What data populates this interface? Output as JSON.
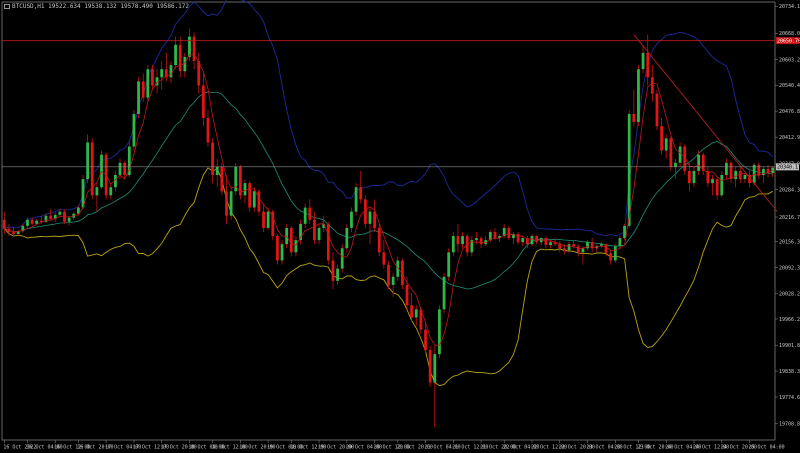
{
  "title": {
    "symbol": "BTCUSD,H1",
    "ohlc": "19522.634 19538.132 19578.490 19586.172"
  },
  "colors": {
    "background": "#000000",
    "frame": "#7f7f7f",
    "bull": "#2fb84a",
    "bear": "#e01515",
    "wick": "#c81414",
    "upper_band": "#1c2a9c",
    "middle_band": "#1f8f7a",
    "lower_band": "#b8a414",
    "fast_ma": "#c01a1a",
    "trendline": "#b01c1c",
    "level_line": "#c01a1a",
    "bid_line": "#8c8c8c",
    "level_tag": "#c81414",
    "bid_tag": "#bcbcbc",
    "text": "#c8c8c8"
  },
  "chart_data": {
    "type": "candlestick",
    "ylim": [
      19669,
      20745
    ],
    "price_ticks": [
      {
        "v": 20734.172,
        "label": "20734.172"
      },
      {
        "v": 20668.08,
        "label": "20668.080"
      },
      {
        "v": 20603.22,
        "label": "20603.220"
      },
      {
        "v": 20540.44,
        "label": "20540.440"
      },
      {
        "v": 20476.88,
        "label": "20476.880"
      },
      {
        "v": 20412.9,
        "label": "20412.900"
      },
      {
        "v": 20347.95,
        "label": "20347.950"
      },
      {
        "v": 20284.38,
        "label": "20284.380"
      },
      {
        "v": 20216.75,
        "label": "20216.750"
      },
      {
        "v": 20156.38,
        "label": "20156.380"
      },
      {
        "v": 20092.315,
        "label": "20092.315"
      },
      {
        "v": 20028.235,
        "label": "20028.235"
      },
      {
        "v": 19966.21,
        "label": "19966.210"
      },
      {
        "v": 19901.88,
        "label": "19901.880"
      },
      {
        "v": 19838.395,
        "label": "19838.395"
      },
      {
        "v": 19774.69,
        "label": "19774.690"
      },
      {
        "v": 19708.825,
        "label": "19708.825"
      },
      {
        "v": 19646.15,
        "label": "19646.150"
      },
      {
        "v": 19580.62,
        "label": "19580.620"
      },
      {
        "v": 19519.45,
        "label": "19519.450"
      },
      {
        "v": 19458.595,
        "label": "19458.595"
      },
      {
        "v": 19393.05,
        "label": "19393.050"
      },
      {
        "v": 19326.79,
        "label": "19326.790"
      }
    ],
    "time_ticks": [
      {
        "i": 0,
        "label": "16 Oct 2022"
      },
      {
        "i": 5,
        "label": "16 Oct 04:00"
      },
      {
        "i": 11,
        "label": "16 Oct 12:00"
      },
      {
        "i": 16,
        "label": "16 Oct 20:00"
      },
      {
        "i": 22,
        "label": "17 Oct 04:00"
      },
      {
        "i": 28,
        "label": "17 Oct 12:00"
      },
      {
        "i": 34,
        "label": "17 Oct 20:00"
      },
      {
        "i": 40,
        "label": "18 Oct 04:00"
      },
      {
        "i": 45,
        "label": "18 Oct 12:00"
      },
      {
        "i": 51,
        "label": "18 Oct 20:00"
      },
      {
        "i": 57,
        "label": "19 Oct 04:00"
      },
      {
        "i": 62,
        "label": "19 Oct 12:00"
      },
      {
        "i": 68,
        "label": "19 Oct 20:00"
      },
      {
        "i": 74,
        "label": "20 Oct 04:00"
      },
      {
        "i": 80,
        "label": "20 Oct 12:00"
      },
      {
        "i": 85,
        "label": "20 Oct 20:00"
      },
      {
        "i": 91,
        "label": "21 Oct 04:00"
      },
      {
        "i": 97,
        "label": "21 Oct 12:00"
      },
      {
        "i": 103,
        "label": "21 Oct 20:00"
      },
      {
        "i": 108,
        "label": "22 Oct 04:00"
      },
      {
        "i": 114,
        "label": "22 Oct 12:00"
      },
      {
        "i": 120,
        "label": "22 Oct 20:00"
      },
      {
        "i": 126,
        "label": "23 Oct 04:00"
      },
      {
        "i": 132,
        "label": "23 Oct 12:00"
      },
      {
        "i": 137,
        "label": "23 Oct 20:00"
      },
      {
        "i": 143,
        "label": "24 Oct 04:00"
      },
      {
        "i": 149,
        "label": "24 Oct 12:00"
      },
      {
        "i": 155,
        "label": "24 Oct 20:00"
      },
      {
        "i": 161,
        "label": "25 Oct 04:00"
      }
    ],
    "horizontal_level": {
      "v": 20650,
      "label": "20650.762"
    },
    "bid_level": {
      "v": 20340,
      "label": "20340.172"
    },
    "trendline": {
      "from": {
        "i": 136,
        "v": 20665
      },
      "to": {
        "i": 167,
        "v": 20230
      }
    },
    "candles": [
      [
        20210,
        20230,
        20175,
        20188
      ],
      [
        20188,
        20200,
        20170,
        20180
      ],
      [
        20180,
        20192,
        20168,
        20175
      ],
      [
        20175,
        20185,
        20170,
        20182
      ],
      [
        20182,
        20200,
        20178,
        20195
      ],
      [
        20195,
        20215,
        20190,
        20210
      ],
      [
        20210,
        20216,
        20195,
        20200
      ],
      [
        20200,
        20212,
        20198,
        20208
      ],
      [
        20208,
        20220,
        20200,
        20205
      ],
      [
        20205,
        20225,
        20202,
        20220
      ],
      [
        20220,
        20236,
        20210,
        20212
      ],
      [
        20212,
        20228,
        20205,
        20222
      ],
      [
        20222,
        20236,
        20218,
        20230
      ],
      [
        20230,
        20236,
        20200,
        20205
      ],
      [
        20205,
        20220,
        20195,
        20215
      ],
      [
        20215,
        20230,
        20210,
        20225
      ],
      [
        20225,
        20245,
        20220,
        20240
      ],
      [
        20240,
        20320,
        20235,
        20310
      ],
      [
        20310,
        20420,
        20300,
        20400
      ],
      [
        20400,
        20410,
        20260,
        20270
      ],
      [
        20270,
        20300,
        20230,
        20290
      ],
      [
        20290,
        20380,
        20285,
        20370
      ],
      [
        20370,
        20375,
        20260,
        20270
      ],
      [
        20270,
        20300,
        20260,
        20290
      ],
      [
        20290,
        20330,
        20280,
        20320
      ],
      [
        20320,
        20360,
        20310,
        20350
      ],
      [
        20350,
        20355,
        20310,
        20320
      ],
      [
        20320,
        20400,
        20315,
        20390
      ],
      [
        20390,
        20480,
        20380,
        20470
      ],
      [
        20470,
        20560,
        20460,
        20550
      ],
      [
        20550,
        20570,
        20500,
        20510
      ],
      [
        20510,
        20590,
        20500,
        20580
      ],
      [
        20580,
        20590,
        20530,
        20540
      ],
      [
        20540,
        20580,
        20520,
        20560
      ],
      [
        20560,
        20600,
        20530,
        20580
      ],
      [
        20580,
        20620,
        20550,
        20560
      ],
      [
        20560,
        20600,
        20545,
        20590
      ],
      [
        20590,
        20660,
        20580,
        20640
      ],
      [
        20640,
        20660,
        20560,
        20575
      ],
      [
        20575,
        20620,
        20560,
        20610
      ],
      [
        20610,
        20680,
        20600,
        20660
      ],
      [
        20660,
        20670,
        20580,
        20600
      ],
      [
        20600,
        20620,
        20520,
        20540
      ],
      [
        20540,
        20570,
        20440,
        20460
      ],
      [
        20460,
        20480,
        20390,
        20400
      ],
      [
        20400,
        20410,
        20300,
        20320
      ],
      [
        20320,
        20360,
        20290,
        20340
      ],
      [
        20340,
        20350,
        20270,
        20280
      ],
      [
        20280,
        20320,
        20200,
        20220
      ],
      [
        20220,
        20290,
        20210,
        20280
      ],
      [
        20280,
        20350,
        20270,
        20340
      ],
      [
        20340,
        20345,
        20260,
        20270
      ],
      [
        20270,
        20310,
        20250,
        20300
      ],
      [
        20300,
        20305,
        20230,
        20240
      ],
      [
        20240,
        20290,
        20230,
        20280
      ],
      [
        20280,
        20285,
        20220,
        20230
      ],
      [
        20230,
        20250,
        20180,
        20190
      ],
      [
        20190,
        20240,
        20185,
        20230
      ],
      [
        20230,
        20235,
        20160,
        20170
      ],
      [
        20170,
        20175,
        20100,
        20110
      ],
      [
        20110,
        20160,
        20100,
        20150
      ],
      [
        20150,
        20200,
        20140,
        20190
      ],
      [
        20190,
        20195,
        20120,
        20130
      ],
      [
        20130,
        20170,
        20120,
        20160
      ],
      [
        20160,
        20210,
        20150,
        20200
      ],
      [
        20200,
        20250,
        20190,
        20240
      ],
      [
        20240,
        20260,
        20200,
        20210
      ],
      [
        20210,
        20230,
        20150,
        20160
      ],
      [
        20160,
        20200,
        20150,
        20190
      ],
      [
        20190,
        20220,
        20180,
        20200
      ],
      [
        20200,
        20205,
        20100,
        20110
      ],
      [
        20110,
        20130,
        20040,
        20060
      ],
      [
        20060,
        20100,
        20050,
        20090
      ],
      [
        20090,
        20150,
        20080,
        20140
      ],
      [
        20140,
        20200,
        20130,
        20190
      ],
      [
        20190,
        20240,
        20180,
        20230
      ],
      [
        20230,
        20300,
        20220,
        20290
      ],
      [
        20290,
        20330,
        20250,
        20260
      ],
      [
        20260,
        20270,
        20190,
        20200
      ],
      [
        20200,
        20240,
        20150,
        20230
      ],
      [
        20230,
        20260,
        20180,
        20190
      ],
      [
        20190,
        20200,
        20120,
        20130
      ],
      [
        20130,
        20160,
        20090,
        20100
      ],
      [
        20100,
        20110,
        20040,
        20050
      ],
      [
        20050,
        20080,
        20020,
        20070
      ],
      [
        20070,
        20120,
        20060,
        20110
      ],
      [
        20110,
        20115,
        20040,
        20050
      ],
      [
        20050,
        20070,
        19990,
        20000
      ],
      [
        20000,
        20030,
        19960,
        19970
      ],
      [
        19970,
        20000,
        19950,
        19990
      ],
      [
        19990,
        19995,
        19930,
        19940
      ],
      [
        19940,
        19960,
        19880,
        19890
      ],
      [
        19890,
        19900,
        19800,
        19810
      ],
      [
        19810,
        19900,
        19700,
        19880
      ],
      [
        19880,
        20000,
        19870,
        19990
      ],
      [
        19990,
        20080,
        19980,
        20070
      ],
      [
        20070,
        20140,
        20060,
        20130
      ],
      [
        20130,
        20180,
        20120,
        20170
      ],
      [
        20170,
        20200,
        20130,
        20150
      ],
      [
        20150,
        20180,
        20140,
        20170
      ],
      [
        20170,
        20175,
        20120,
        20130
      ],
      [
        20130,
        20170,
        20120,
        20160
      ],
      [
        20160,
        20180,
        20150,
        20165
      ],
      [
        20165,
        20170,
        20140,
        20150
      ],
      [
        20150,
        20170,
        20145,
        20160
      ],
      [
        20160,
        20185,
        20155,
        20180
      ],
      [
        20180,
        20190,
        20160,
        20165
      ],
      [
        20165,
        20175,
        20155,
        20170
      ],
      [
        20170,
        20200,
        20165,
        20190
      ],
      [
        20190,
        20195,
        20160,
        20165
      ],
      [
        20165,
        20180,
        20150,
        20175
      ],
      [
        20175,
        20180,
        20150,
        20155
      ],
      [
        20155,
        20170,
        20145,
        20165
      ],
      [
        20165,
        20170,
        20140,
        20150
      ],
      [
        20150,
        20175,
        20145,
        20170
      ],
      [
        20170,
        20172,
        20150,
        20155
      ],
      [
        20155,
        20168,
        20148,
        20165
      ],
      [
        20165,
        20170,
        20140,
        20148
      ],
      [
        20148,
        20160,
        20140,
        20155
      ],
      [
        20155,
        20165,
        20145,
        20150
      ],
      [
        20150,
        20158,
        20130,
        20140
      ],
      [
        20140,
        20150,
        20125,
        20135
      ],
      [
        20135,
        20155,
        20130,
        20150
      ],
      [
        20150,
        20160,
        20140,
        20145
      ],
      [
        20145,
        20150,
        20120,
        20130
      ],
      [
        20130,
        20145,
        20100,
        20140
      ],
      [
        20140,
        20160,
        20135,
        20155
      ],
      [
        20155,
        20165,
        20130,
        20140
      ],
      [
        20140,
        20150,
        20130,
        20145
      ],
      [
        20145,
        20155,
        20140,
        20150
      ],
      [
        20150,
        20152,
        20120,
        20128
      ],
      [
        20128,
        20135,
        20100,
        20110
      ],
      [
        20110,
        20150,
        20105,
        20145
      ],
      [
        20145,
        20170,
        20140,
        20165
      ],
      [
        20165,
        20200,
        20160,
        20195
      ],
      [
        20195,
        20480,
        20190,
        20470
      ],
      [
        20470,
        20530,
        20440,
        20450
      ],
      [
        20450,
        20590,
        20440,
        20580
      ],
      [
        20580,
        20640,
        20570,
        20620
      ],
      [
        20620,
        20665,
        20540,
        20560
      ],
      [
        20560,
        20590,
        20500,
        20520
      ],
      [
        20520,
        20530,
        20430,
        20440
      ],
      [
        20440,
        20460,
        20370,
        20380
      ],
      [
        20380,
        20420,
        20360,
        20410
      ],
      [
        20410,
        20415,
        20330,
        20340
      ],
      [
        20340,
        20360,
        20310,
        20350
      ],
      [
        20350,
        20400,
        20340,
        20390
      ],
      [
        20390,
        20395,
        20320,
        20330
      ],
      [
        20330,
        20350,
        20280,
        20300
      ],
      [
        20300,
        20340,
        20290,
        20330
      ],
      [
        20330,
        20380,
        20320,
        20370
      ],
      [
        20370,
        20375,
        20320,
        20330
      ],
      [
        20330,
        20340,
        20290,
        20300
      ],
      [
        20300,
        20320,
        20270,
        20310
      ],
      [
        20310,
        20315,
        20260,
        20270
      ],
      [
        20270,
        20330,
        20265,
        20320
      ],
      [
        20320,
        20360,
        20310,
        20350
      ],
      [
        20350,
        20355,
        20300,
        20310
      ],
      [
        20310,
        20340,
        20290,
        20330
      ],
      [
        20330,
        20340,
        20300,
        20310
      ],
      [
        20310,
        20325,
        20300,
        20320
      ],
      [
        20320,
        20330,
        20290,
        20300
      ],
      [
        20300,
        20350,
        20295,
        20345
      ],
      [
        20345,
        20350,
        20310,
        20320
      ],
      [
        20320,
        20340,
        20300,
        20335
      ],
      [
        20335,
        20345,
        20315,
        20325
      ],
      [
        20325,
        20340,
        20315,
        20338
      ]
    ]
  }
}
